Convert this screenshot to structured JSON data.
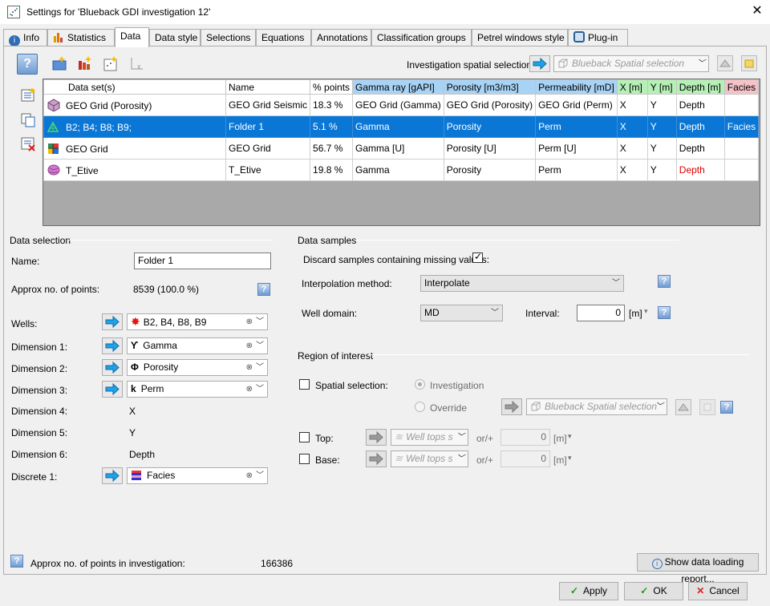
{
  "window": {
    "title": "Settings for 'Blueback GDI investigation 12'"
  },
  "tabs": [
    {
      "label": "Info"
    },
    {
      "label": "Statistics"
    },
    {
      "label": "Data"
    },
    {
      "label": "Data style"
    },
    {
      "label": "Selections"
    },
    {
      "label": "Equations"
    },
    {
      "label": "Annotations"
    },
    {
      "label": "Classification groups"
    },
    {
      "label": "Petrel windows style"
    },
    {
      "label": "Plug-in"
    }
  ],
  "toolbar": {
    "spatial_label": "Investigation spatial selection:",
    "spatial_value": "Blueback Spatial selection"
  },
  "grid": {
    "headers": [
      "Data set(s)",
      "Name",
      "% points",
      "Gamma ray [gAPI]",
      "Porosity [m3/m3]",
      "Permeability [mD]",
      "X [m]",
      "Y [m]",
      "Depth [m]",
      "Facies"
    ],
    "rows": [
      [
        "GEO Grid (Porosity)",
        "GEO Grid Seismic",
        "18.3 %",
        "GEO Grid (Gamma)",
        "GEO Grid (Porosity)",
        "GEO Grid (Perm)",
        "X",
        "Y",
        "Depth",
        ""
      ],
      [
        "B2; B4; B8; B9;",
        "Folder 1",
        "5.1 %",
        "Gamma",
        "Porosity",
        "Perm",
        "X",
        "Y",
        "Depth",
        "Facies"
      ],
      [
        "GEO Grid",
        "GEO Grid",
        "56.7 %",
        "Gamma [U]",
        "Porosity [U]",
        "Perm [U]",
        "X",
        "Y",
        "Depth",
        ""
      ],
      [
        "T_Etive",
        "T_Etive",
        "19.8 %",
        "Gamma",
        "Porosity",
        "Perm",
        "X",
        "Y",
        "Depth",
        ""
      ]
    ],
    "header_colors": {
      "gamma": "#a8d3f5",
      "porosity": "#a8d3f5",
      "perm": "#a8d3f5",
      "x": "#b6f0b6",
      "y": "#b6f0b6",
      "depth": "#b6f0b6",
      "facies": "#f5c2c7"
    },
    "warn_color": "#e00000",
    "selected_color": "#0a77d6"
  },
  "data_selection": {
    "title": "Data selection",
    "name_label": "Name:",
    "name_value": "Folder 1",
    "points_label": "Approx no. of points:",
    "points_value": "8539 (100.0 %)",
    "wells_label": "Wells:",
    "wells_value": "B2, B4, B8, B9",
    "dim1_label": "Dimension 1:",
    "dim1_value": "Gamma",
    "dim2_label": "Dimension 2:",
    "dim2_value": "Porosity",
    "dim3_label": "Dimension 3:",
    "dim3_value": "Perm",
    "dim4_label": "Dimension 4:",
    "dim4_value": "X",
    "dim5_label": "Dimension 5:",
    "dim5_value": "Y",
    "dim6_label": "Dimension 6:",
    "dim6_value": "Depth",
    "discrete_label": "Discrete 1:",
    "discrete_value": "Facies"
  },
  "data_samples": {
    "title": "Data samples",
    "discard_label": "Discard samples containing missing values:",
    "interp_label": "Interpolation method:",
    "interp_value": "Interpolate",
    "domain_label": "Well domain:",
    "domain_value": "MD",
    "interval_label": "Interval:",
    "interval_value": "0",
    "interval_unit": "[m]"
  },
  "roi": {
    "title": "Region of interest",
    "spatial_label": "Spatial selection:",
    "investigation_label": "Investigation",
    "override_label": "Override",
    "override_value": "Blueback Spatial selection",
    "top_label": "Top:",
    "top_combo": "Well tops s",
    "top_or": "or/+",
    "top_value": "0",
    "top_unit": "[m]",
    "base_label": "Base:",
    "base_combo": "Well tops s",
    "base_or": "or/+",
    "base_value": "0",
    "base_unit": "[m]"
  },
  "footer": {
    "points_label": "Approx no. of points in investigation:",
    "points_value": "166386",
    "report_label": "Show data loading report...",
    "apply_label": "Apply",
    "ok_label": "OK",
    "cancel_label": "Cancel"
  },
  "icons": {
    "wells": "red-star-icon",
    "gamma": "gamma-icon",
    "porosity": "phi-icon",
    "perm": "perm-icon",
    "facies": "facies-icon"
  }
}
